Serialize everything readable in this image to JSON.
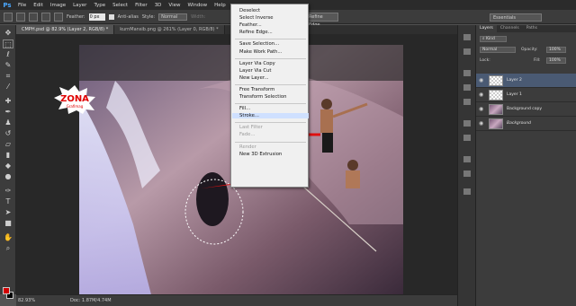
{
  "app": {
    "logo": "Ps",
    "menu": [
      "File",
      "Edit",
      "Image",
      "Layer",
      "Type",
      "Select",
      "Filter",
      "3D",
      "View",
      "Window",
      "Help"
    ]
  },
  "options_bar": {
    "feather_label": "Feather:",
    "feather_value": "0 px",
    "antialias_label": "Anti-alias",
    "style_label": "Style:",
    "style_value": "Normal",
    "width_label": "Width:",
    "refine_edge_label": "Refine Edge...",
    "workspace": "Essentials"
  },
  "tabs": [
    {
      "label": "CMPH.psd @ 82.9% (Layer 2, RGB/8) *",
      "active": true
    },
    {
      "label": "kurnMansib.png @ 261% (Layer 0, RGB/8) *",
      "active": false
    }
  ],
  "status": {
    "zoom": "82.93%",
    "doc": "Doc: 1.87M/4.74M"
  },
  "context_menu": {
    "items": [
      {
        "label": "Deselect",
        "disabled": false
      },
      {
        "label": "Select Inverse",
        "disabled": false
      },
      {
        "label": "Feather...",
        "disabled": false
      },
      {
        "label": "Refine Edge...",
        "disabled": false
      },
      {
        "sep": true
      },
      {
        "label": "Save Selection...",
        "disabled": false
      },
      {
        "label": "Make Work Path...",
        "disabled": false
      },
      {
        "sep": true
      },
      {
        "label": "Layer Via Copy",
        "disabled": false
      },
      {
        "label": "Layer Via Cut",
        "disabled": false
      },
      {
        "label": "New Layer...",
        "disabled": false
      },
      {
        "sep": true
      },
      {
        "label": "Free Transform",
        "disabled": false
      },
      {
        "label": "Transform Selection",
        "disabled": false
      },
      {
        "sep": true
      },
      {
        "label": "Fill...",
        "disabled": false
      },
      {
        "label": "Stroke...",
        "disabled": false,
        "highlighted": true
      },
      {
        "sep": true
      },
      {
        "label": "Last Filter",
        "disabled": true
      },
      {
        "label": "Fade...",
        "disabled": true
      },
      {
        "sep": true
      },
      {
        "label": "Render",
        "disabled": true
      },
      {
        "label": "New 3D Extrusion",
        "disabled": false
      }
    ]
  },
  "layers_panel": {
    "tabs": [
      "Layers",
      "Channels",
      "Paths"
    ],
    "kind_label": "Kind",
    "blend_mode": "Normal",
    "opacity_label": "Opacity:",
    "opacity_value": "100%",
    "lock_label": "Lock:",
    "fill_label": "Fill:",
    "fill_value": "100%",
    "layers": [
      {
        "name": "Layer 2",
        "thumb": "checker",
        "selected": true,
        "italic": false
      },
      {
        "name": "Layer 1",
        "thumb": "checker",
        "selected": false,
        "italic": false
      },
      {
        "name": "Background copy",
        "thumb": "photo",
        "selected": false,
        "italic": false
      },
      {
        "name": "Background",
        "thumb": "photo",
        "selected": false,
        "italic": true
      }
    ]
  },
  "watermark": {
    "text": "ZONA",
    "subtext": "Grafimag"
  },
  "colors": {
    "foreground": "#d10000",
    "background": "#000000",
    "arrow": "#e01010"
  }
}
